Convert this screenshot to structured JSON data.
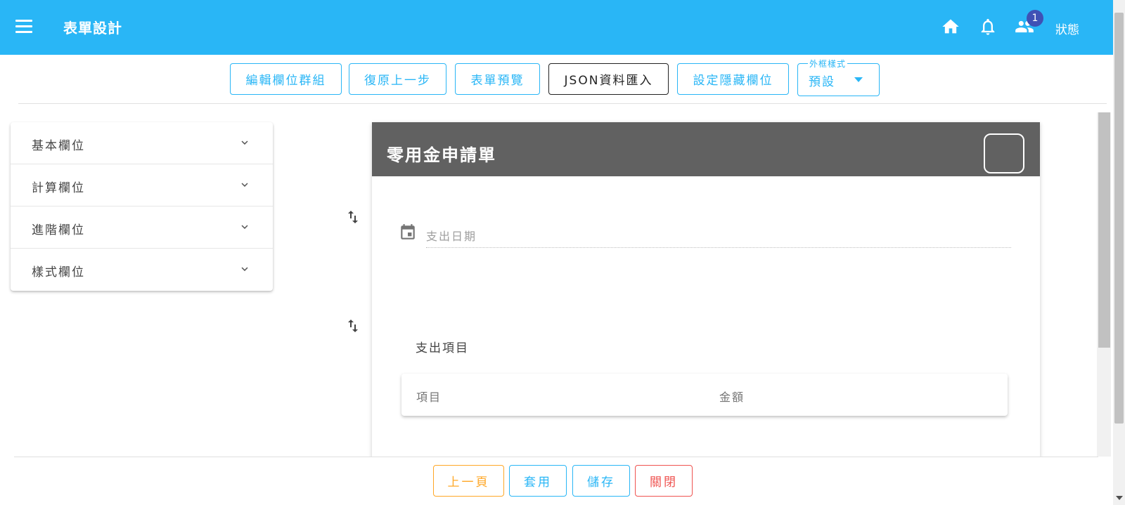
{
  "appbar": {
    "title": "表單設計",
    "notification_count": "1",
    "status_label": "狀態",
    "background": "#29b6f6",
    "icons": [
      "menu-icon",
      "home-icon",
      "bell-icon",
      "people-icon"
    ]
  },
  "toolbar": {
    "buttons": [
      {
        "label": "編輯欄位群組"
      },
      {
        "label": "復原上一步"
      },
      {
        "label": "表單預覽"
      },
      {
        "label": "JSON資料匯入"
      },
      {
        "label": "設定隱藏欄位"
      }
    ],
    "frame_style": {
      "legend": "外框樣式",
      "value": "預設"
    }
  },
  "field_panel": {
    "items": [
      {
        "label": "基本欄位"
      },
      {
        "label": "計算欄位"
      },
      {
        "label": "進階欄位"
      },
      {
        "label": "樣式欄位"
      }
    ]
  },
  "form": {
    "title": "零用金申請單",
    "header_color": "#616161",
    "date_field": {
      "placeholder": "支出日期"
    },
    "items_section": {
      "label": "支出項目",
      "columns": [
        "項目",
        "金額"
      ]
    }
  },
  "footer": {
    "prev_label": "上一頁",
    "apply_label": "套用",
    "save_label": "儲存",
    "close_label": "關閉"
  },
  "colors": {
    "primary": "#29b6f6",
    "warning": "#ffa726",
    "danger": "#ef5350",
    "badge": "#3f51b5"
  }
}
